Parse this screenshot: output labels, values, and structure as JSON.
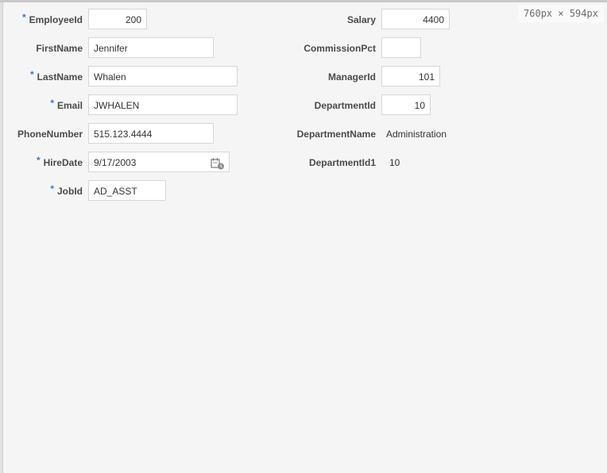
{
  "viewport_badge": "760px × 594px",
  "form": {
    "left": {
      "employee_id": {
        "label": "EmployeeId",
        "required": "*",
        "value": "200"
      },
      "first_name": {
        "label": "FirstName",
        "value": "Jennifer"
      },
      "last_name": {
        "label": "LastName",
        "required": "*",
        "value": "Whalen"
      },
      "email": {
        "label": "Email",
        "required": "*",
        "value": "JWHALEN"
      },
      "phone_number": {
        "label": "PhoneNumber",
        "value": "515.123.4444"
      },
      "hire_date": {
        "label": "HireDate",
        "required": "*",
        "value": "9/17/2003",
        "icon": "calendar-icon"
      },
      "job_id": {
        "label": "JobId",
        "required": "*",
        "value": "AD_ASST"
      }
    },
    "right": {
      "salary": {
        "label": "Salary",
        "value": "4400"
      },
      "commission_pct": {
        "label": "CommissionPct",
        "value": ""
      },
      "manager_id": {
        "label": "ManagerId",
        "value": "101"
      },
      "department_id": {
        "label": "DepartmentId",
        "value": "10"
      },
      "department_name": {
        "label": "DepartmentName",
        "value": "Administration"
      },
      "department_id1": {
        "label": "DepartmentId1",
        "value": "10"
      }
    }
  },
  "colors": {
    "required_marker": "#3a78c8",
    "background": "#f5f5f5",
    "field_border": "#d6d6d6"
  }
}
